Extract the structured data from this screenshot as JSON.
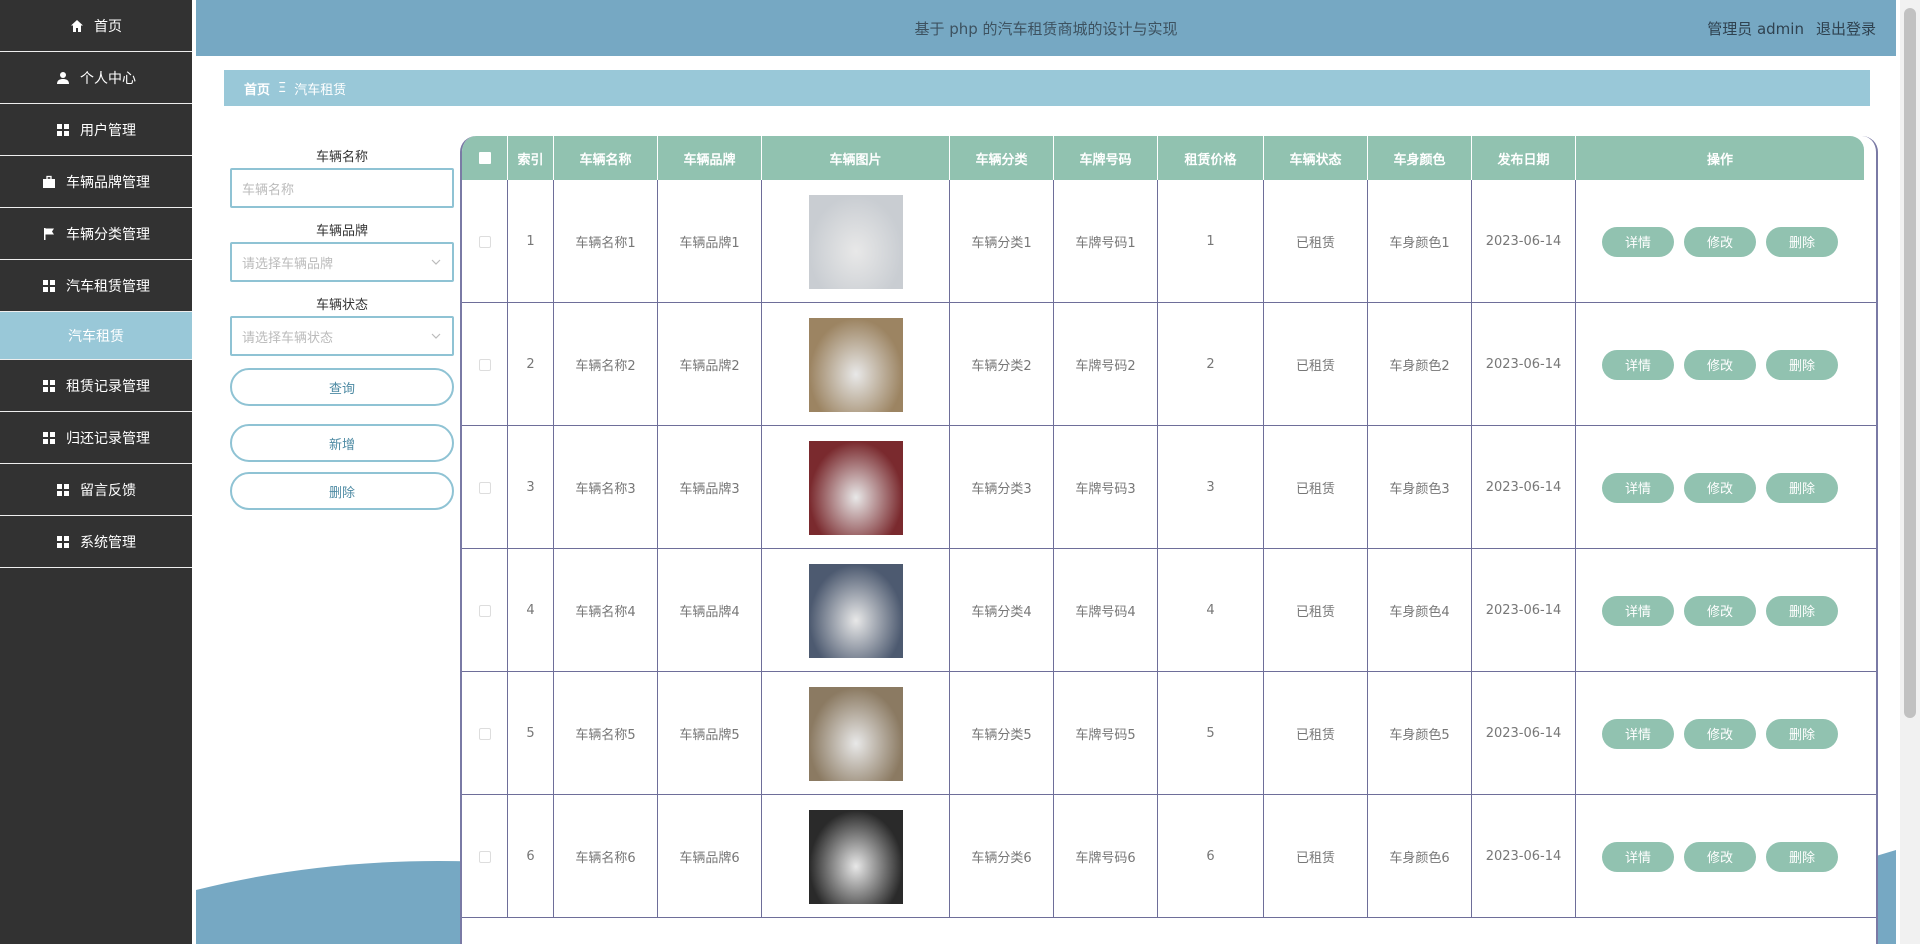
{
  "sidebar": {
    "items": [
      {
        "label": "首页",
        "icon": "home-icon"
      },
      {
        "label": "个人中心",
        "icon": "user-icon"
      },
      {
        "label": "用户管理",
        "icon": "grid-icon"
      },
      {
        "label": "车辆品牌管理",
        "icon": "briefcase-icon"
      },
      {
        "label": "车辆分类管理",
        "icon": "flag-icon"
      },
      {
        "label": "汽车租赁管理",
        "icon": "grid-icon"
      },
      {
        "label": "汽车租赁",
        "icon": "",
        "sub": true
      },
      {
        "label": "租赁记录管理",
        "icon": "grid-icon"
      },
      {
        "label": "归还记录管理",
        "icon": "grid-icon"
      },
      {
        "label": "留言反馈",
        "icon": "grid-icon"
      },
      {
        "label": "系统管理",
        "icon": "grid-icon"
      }
    ]
  },
  "header": {
    "title": "基于 php 的汽车租赁商城的设计与实现",
    "user": "管理员 admin",
    "logout": "退出登录"
  },
  "breadcrumb": {
    "home": "首页",
    "separator": "Ξ",
    "current": "汽车租赁"
  },
  "search": {
    "name_label": "车辆名称",
    "name_placeholder": "车辆名称",
    "brand_label": "车辆品牌",
    "brand_placeholder": "请选择车辆品牌",
    "status_label": "车辆状态",
    "status_placeholder": "请选择车辆状态",
    "query_button": "查询",
    "add_button": "新增",
    "delete_button": "删除"
  },
  "table": {
    "headers": [
      "",
      "索引",
      "车辆名称",
      "车辆品牌",
      "车辆图片",
      "车辆分类",
      "车牌号码",
      "租赁价格",
      "车辆状态",
      "车身颜色",
      "发布日期",
      "操作"
    ],
    "actions": {
      "detail": "详情",
      "edit": "修改",
      "delete": "删除"
    },
    "rows": [
      {
        "index": "1",
        "name": "车辆名称1",
        "brand": "车辆品牌1",
        "category": "车辆分类1",
        "plate": "车牌号码1",
        "price": "1",
        "status": "已租赁",
        "color": "车身颜色1",
        "date": "2023-06-14",
        "img": "#c9cdd2"
      },
      {
        "index": "2",
        "name": "车辆名称2",
        "brand": "车辆品牌2",
        "category": "车辆分类2",
        "plate": "车牌号码2",
        "price": "2",
        "status": "已租赁",
        "color": "车身颜色2",
        "date": "2023-06-14",
        "img": "#9c8462"
      },
      {
        "index": "3",
        "name": "车辆名称3",
        "brand": "车辆品牌3",
        "category": "车辆分类3",
        "plate": "车牌号码3",
        "price": "3",
        "status": "已租赁",
        "color": "车身颜色3",
        "date": "2023-06-14",
        "img": "#7a2a2e"
      },
      {
        "index": "4",
        "name": "车辆名称4",
        "brand": "车辆品牌4",
        "category": "车辆分类4",
        "plate": "车牌号码4",
        "price": "4",
        "status": "已租赁",
        "color": "车身颜色4",
        "date": "2023-06-14",
        "img": "#4d5a70"
      },
      {
        "index": "5",
        "name": "车辆名称5",
        "brand": "车辆品牌5",
        "category": "车辆分类5",
        "plate": "车牌号码5",
        "price": "5",
        "status": "已租赁",
        "color": "车身颜色5",
        "date": "2023-06-14",
        "img": "#8b7a62"
      },
      {
        "index": "6",
        "name": "车辆名称6",
        "brand": "车辆品牌6",
        "category": "车辆分类6",
        "plate": "车牌号码6",
        "price": "6",
        "status": "已租赁",
        "color": "车身颜色6",
        "date": "2023-06-14",
        "img": "#2a2a2a"
      }
    ]
  },
  "colors": {
    "sidebar_bg": "#323232",
    "topbar_bg": "#76a8c3",
    "breadcrumb_bg": "#99c8d8",
    "table_header_bg": "#91c2b0",
    "action_button_bg": "#91c2b0"
  }
}
